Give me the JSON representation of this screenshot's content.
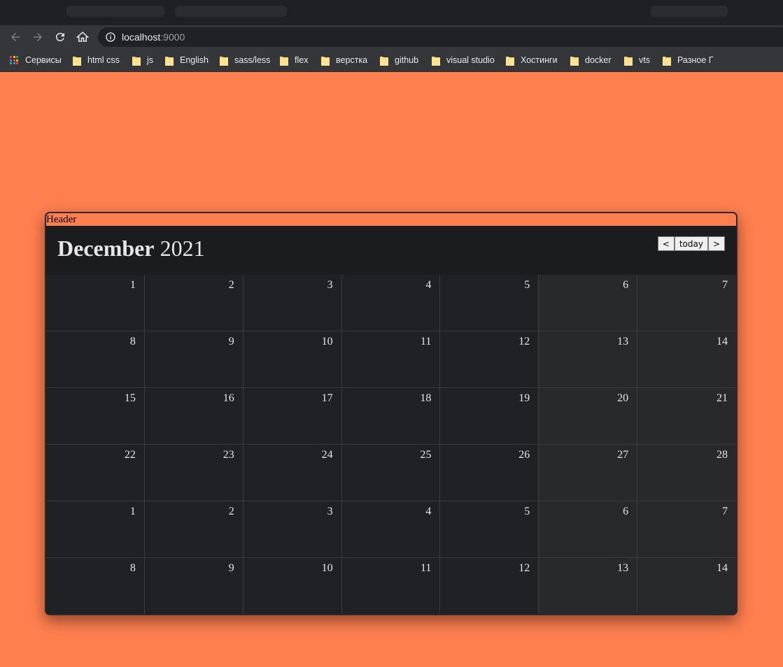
{
  "browser": {
    "url_host": "localhost",
    "url_port": ":9000",
    "bookmarks": [
      {
        "label": "Сервисы",
        "icon": "apps-icon"
      },
      {
        "label": "html css",
        "icon": "folder-icon"
      },
      {
        "label": "js",
        "icon": "folder-icon"
      },
      {
        "label": "English",
        "icon": "folder-icon"
      },
      {
        "label": "sass/less",
        "icon": "folder-icon"
      },
      {
        "label": "flex",
        "icon": "folder-icon"
      },
      {
        "label": "верстка",
        "icon": "folder-icon"
      },
      {
        "label": "github",
        "icon": "folder-icon"
      },
      {
        "label": "visual studio",
        "icon": "folder-icon"
      },
      {
        "label": "Хостинги",
        "icon": "folder-icon"
      },
      {
        "label": "docker",
        "icon": "folder-icon"
      },
      {
        "label": "vts",
        "icon": "folder-icon"
      },
      {
        "label": "Разное Г",
        "icon": "folder-icon"
      }
    ]
  },
  "calendar": {
    "header_label": "Header",
    "month": "December",
    "year": "2021",
    "prev_label": "<",
    "today_label": "today",
    "next_label": ">",
    "days": [
      "1",
      "2",
      "3",
      "4",
      "5",
      "6",
      "7",
      "8",
      "9",
      "10",
      "11",
      "12",
      "13",
      "14",
      "15",
      "16",
      "17",
      "18",
      "19",
      "20",
      "21",
      "22",
      "23",
      "24",
      "25",
      "26",
      "27",
      "28",
      "1",
      "2",
      "3",
      "4",
      "5",
      "6",
      "7",
      "8",
      "9",
      "10",
      "11",
      "12",
      "13",
      "14"
    ]
  },
  "colors": {
    "page_background": "#ff7f4f",
    "calendar_background": "#202124",
    "weekend_background": "#28292b"
  }
}
